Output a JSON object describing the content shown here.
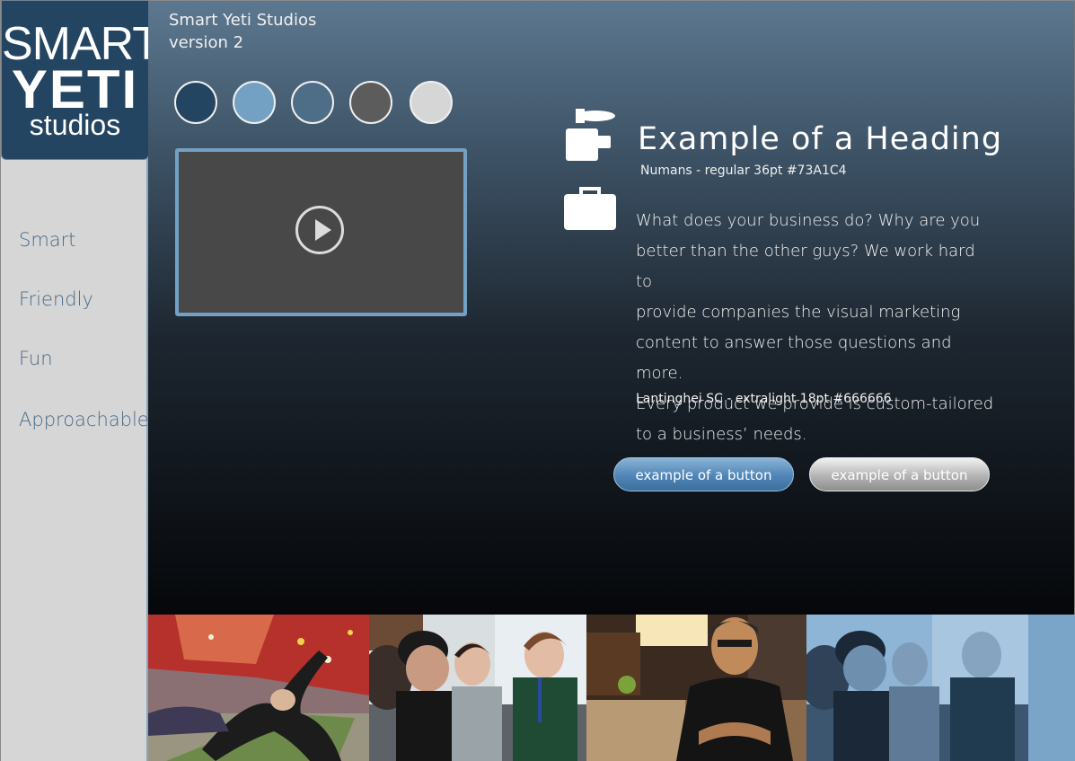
{
  "brand": {
    "logo_line1": "SMART",
    "logo_line2": "YETI",
    "logo_line3": "studios"
  },
  "sidebar": {
    "items": [
      {
        "label": "Smart"
      },
      {
        "label": "Friendly"
      },
      {
        "label": "Fun"
      },
      {
        "label": "Approachable"
      }
    ]
  },
  "header": {
    "title": "Smart Yeti Studios",
    "version": "version 2"
  },
  "palette": {
    "colors": [
      "#234561",
      "#73a1c4",
      "#4e6e88",
      "#5c5c5c",
      "#d6d6d6"
    ]
  },
  "video": {
    "play_icon": "play-icon"
  },
  "content": {
    "heading": "Example of a Heading",
    "heading_note": "Numans - regular 36pt #73A1C4",
    "body_lines": [
      "What does your business do? Why are you",
      "better than the other guys? We work hard to",
      "provide companies the visual marketing",
      "content to answer those questions and more.",
      "Every product we provide is custom-tailored",
      "to a business’ needs."
    ],
    "body_note": "Lantinghei SC - extralight 18pt #666666",
    "heading_icon": "camera-icon",
    "body_icon": "briefcase-icon"
  },
  "buttons": {
    "primary_label": "example of a button",
    "secondary_label": "example of a button"
  },
  "photos": {
    "items": [
      "yoga-class-photo",
      "group-discussion-photo",
      "portrait-photo",
      "group-discussion-tinted-photo"
    ]
  }
}
